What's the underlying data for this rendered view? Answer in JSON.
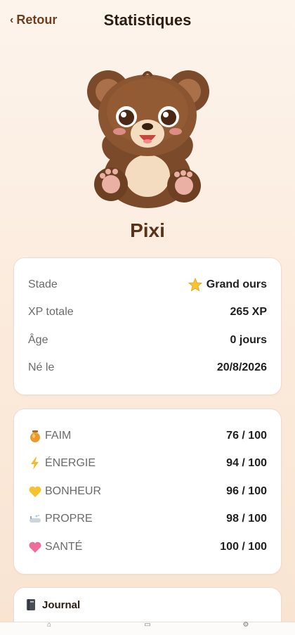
{
  "header": {
    "back_label": "Retour",
    "title": "Statistiques"
  },
  "pet": {
    "name": "Pixi"
  },
  "info": {
    "rows": [
      {
        "label": "Stade",
        "icon": "star-icon",
        "value": "Grand ours"
      },
      {
        "label": "XP totale",
        "value": "265 XP"
      },
      {
        "label": "Âge",
        "value": "0 jours"
      },
      {
        "label": "Né le",
        "value": "20/8/2026"
      }
    ]
  },
  "stats": {
    "rows": [
      {
        "label": "FAIM",
        "icon": "honey-pot-icon",
        "value": "76 / 100"
      },
      {
        "label": "ÉNERGIE",
        "icon": "lightning-icon",
        "value": "94 / 100"
      },
      {
        "label": "BONHEUR",
        "icon": "yellow-heart-icon",
        "value": "96 / 100"
      },
      {
        "label": "PROPRE",
        "icon": "bathtub-icon",
        "value": "98 / 100"
      },
      {
        "label": "SANTÉ",
        "icon": "pink-heart-icon",
        "value": "100 / 100"
      }
    ]
  },
  "journal": {
    "title": "Journal",
    "icon": "notebook-icon"
  },
  "colors": {
    "accent": "#5a3318",
    "background": "#fbeadb"
  }
}
